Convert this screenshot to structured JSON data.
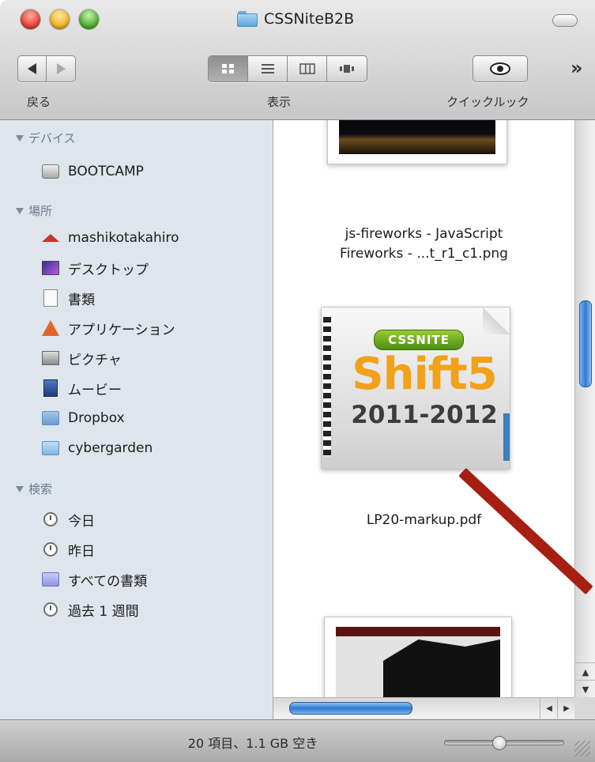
{
  "window": {
    "title": "CSSNiteB2B"
  },
  "toolbar": {
    "back_label": "戻る",
    "view_label": "表示",
    "quicklook_label": "クイックルック",
    "overflow": "»"
  },
  "sidebar": {
    "devices": {
      "header": "デバイス",
      "items": [
        {
          "label": "BOOTCAMP",
          "icon": "disk-icon"
        }
      ]
    },
    "places": {
      "header": "場所",
      "items": [
        {
          "label": "mashikotakahiro",
          "icon": "home-icon"
        },
        {
          "label": "デスクトップ",
          "icon": "desktop-icon"
        },
        {
          "label": "書類",
          "icon": "documents-icon"
        },
        {
          "label": "アプリケーション",
          "icon": "applications-icon"
        },
        {
          "label": "ピクチャ",
          "icon": "pictures-icon"
        },
        {
          "label": "ムービー",
          "icon": "movies-icon"
        },
        {
          "label": "Dropbox",
          "icon": "folder-icon"
        },
        {
          "label": "cybergarden",
          "icon": "folder-icon"
        }
      ]
    },
    "search": {
      "header": "検索",
      "items": [
        {
          "label": "今日",
          "icon": "clock-icon"
        },
        {
          "label": "昨日",
          "icon": "clock-icon"
        },
        {
          "label": "すべての書類",
          "icon": "smart-folder-icon"
        },
        {
          "label": "過去 1 週間",
          "icon": "clock-icon"
        }
      ]
    }
  },
  "content": {
    "files": [
      {
        "name_line1": "js-fireworks - JavaScript",
        "name_line2": "Fireworks - ...t_r1_c1.png"
      },
      {
        "name_line1": "LP20-markup.pdf",
        "thumb_badge": "CSSNITE",
        "thumb_title": "Shift5",
        "thumb_years": "2011-2012"
      },
      {
        "name_line1": ""
      }
    ]
  },
  "status": {
    "text": "20 項目、1.1 GB 空き",
    "zoom_level": 0.45
  },
  "colors": {
    "sidebar_bg": "#dfe5ec",
    "accent_blue": "#2f7ad2",
    "annotation_red": "#a61f12"
  }
}
